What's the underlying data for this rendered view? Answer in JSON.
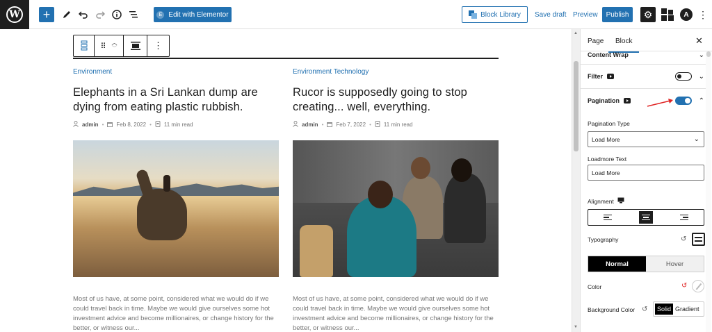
{
  "toolbar": {
    "add_label": "+",
    "edit_elementor_label": "Edit with Elementor",
    "block_library_label": "Block Library",
    "save_draft_label": "Save draft",
    "preview_label": "Preview",
    "publish_label": "Publish"
  },
  "posts": [
    {
      "category": "Environment",
      "title": "Elephants in a Sri Lankan dump are dying from eating plastic rubbish.",
      "author": "admin",
      "date": "Feb 8, 2022",
      "read_time": "11 min read",
      "excerpt": "Most of us have, at some point, considered what we would do if we could travel back in time. Maybe we would give ourselves some hot investment advice and become millionaires, or change history for the better, or witness our..."
    },
    {
      "category": "Environment Technology",
      "title": "Rucor is supposedly going to stop creating... well, everything.",
      "author": "admin",
      "date": "Feb 7, 2022",
      "read_time": "11 min read",
      "excerpt": "Most of us have, at some point, considered what we would do if we could travel back in time. Maybe we would give ourselves some hot investment advice and become millionaires, or change history for the better, or witness our..."
    }
  ],
  "sidebar": {
    "tabs": [
      "Page",
      "Block"
    ],
    "active_tab": "Block",
    "sections": {
      "content_wrap": "Content Wrap",
      "filter": "Filter",
      "pagination": "Pagination"
    },
    "filter_enabled": false,
    "pagination_enabled": true,
    "pagination_type_label": "Pagination Type",
    "pagination_type_value": "Load More",
    "loadmore_text_label": "Loadmore Text",
    "loadmore_text_value": "Load More",
    "alignment_label": "Alignment",
    "alignment_selected": "center",
    "typography_label": "Typography",
    "state_tabs": [
      "Normal",
      "Hover"
    ],
    "active_state": "Normal",
    "color_label": "Color",
    "bg_color_label": "Background Color",
    "bg_options": [
      "Solid",
      "Gradient"
    ],
    "bg_selected": "Solid"
  },
  "colors": {
    "accent": "#2271b1",
    "annotation_arrow": "#e02424"
  }
}
